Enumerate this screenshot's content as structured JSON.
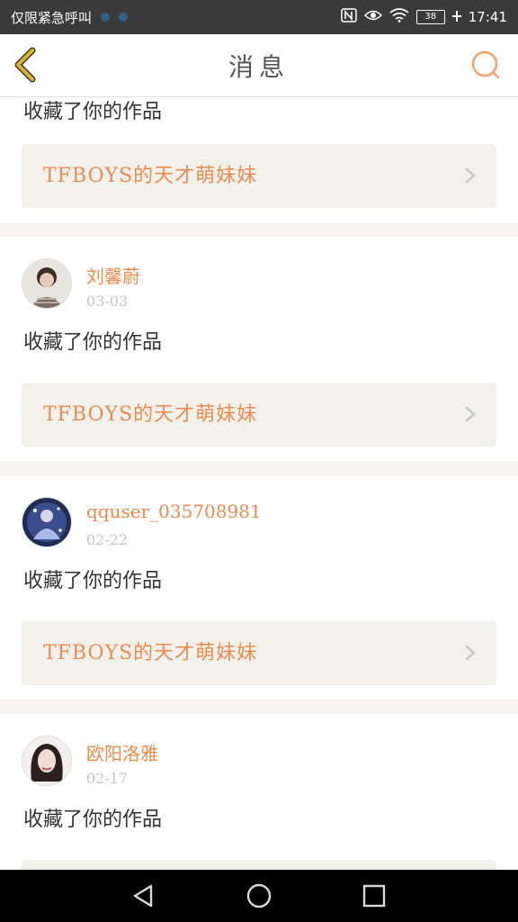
{
  "status_bar": {
    "carrier_text": "仅限紧急呼叫",
    "battery_level": "38",
    "time": "17:41",
    "icons": [
      "nfc-icon",
      "eye-icon",
      "wifi-icon",
      "battery-icon",
      "charging-icon"
    ]
  },
  "header": {
    "title": "消息",
    "back_icon": "chevron-left-icon",
    "search_icon": "search-icon",
    "accent_color": "#f08a4b",
    "back_color": "#e0b42a"
  },
  "top_partial": {
    "action": "收藏了你的作品",
    "work_title": "TFBOYS的天才萌妹妹"
  },
  "messages": [
    {
      "user": "刘馨蔚",
      "date": "03-03",
      "action": "收藏了你的作品",
      "work_title": "TFBOYS的天才萌妹妹"
    },
    {
      "user": "qquser_035708981",
      "date": "02-22",
      "action": "收藏了你的作品",
      "work_title": "TFBOYS的天才萌妹妹"
    },
    {
      "user": "欧阳洛雅",
      "date": "02-17",
      "action": "收藏了你的作品",
      "work_title": ""
    }
  ],
  "nav_bar": {
    "back_icon": "nav-back-icon",
    "home_icon": "nav-home-icon",
    "recents_icon": "nav-recents-icon"
  }
}
